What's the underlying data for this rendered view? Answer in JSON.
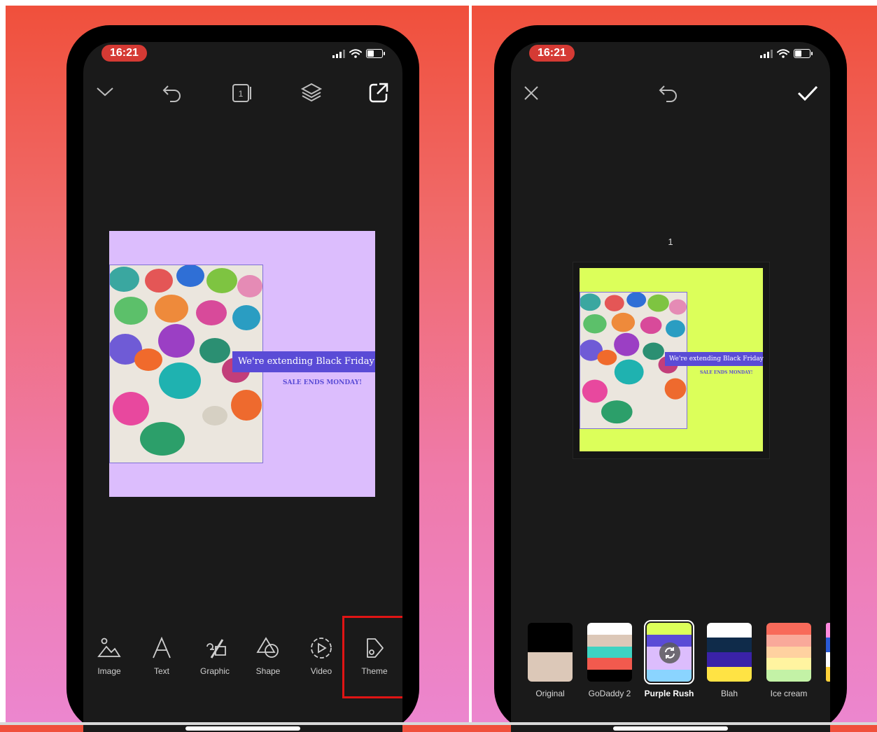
{
  "left_phone": {
    "time": "16:21",
    "design": {
      "banner_text": "We're extending Black Friday",
      "subtitle": "SALE ENDS MONDAY!",
      "background_color": "#dcbdfd",
      "accent_color": "#5a4bd6"
    },
    "toolbar": {
      "image": "Image",
      "text": "Text",
      "graphic": "Graphic",
      "shape": "Shape",
      "video": "Video",
      "theme": "Theme"
    }
  },
  "right_phone": {
    "time": "16:21",
    "page_number": "1",
    "design": {
      "banner_text": "We're extending Black Friday",
      "subtitle": "SALE ENDS MONDAY!",
      "background_color": "#dcff5a"
    },
    "themes": [
      {
        "name": "Original",
        "selected": false
      },
      {
        "name": "GoDaddy 2",
        "selected": false
      },
      {
        "name": "Purple Rush",
        "selected": true
      },
      {
        "name": "Blah",
        "selected": false
      },
      {
        "name": "Ice cream",
        "selected": false
      }
    ]
  },
  "colors": {
    "screen_bg": "#1a1a1a",
    "time_pill": "#d53a34",
    "highlight": "#e01414"
  }
}
